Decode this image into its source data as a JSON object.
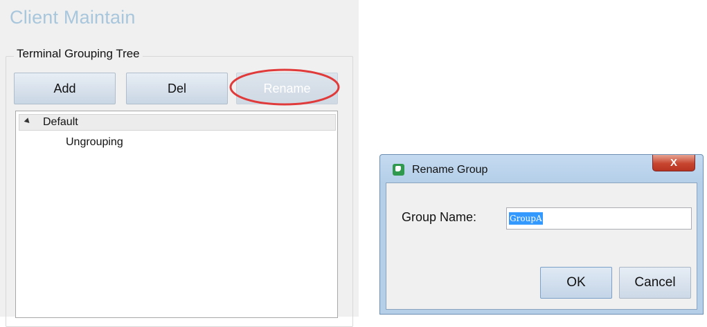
{
  "app": {
    "title": "Client Maintain"
  },
  "tree_panel": {
    "group_label": "Terminal Grouping Tree",
    "buttons": {
      "add": "Add",
      "del": "Del",
      "rename": "Rename"
    },
    "tree": {
      "root": "Default",
      "child": "Ungrouping"
    }
  },
  "dialog": {
    "title": "Rename Group",
    "close_glyph": "X",
    "field_label": "Group Name:",
    "field_value": "GroupA",
    "ok": "OK",
    "cancel": "Cancel"
  },
  "colors": {
    "annotation_ellipse": "#e03a3a",
    "selection": "#3399ff",
    "title_blue": "#a8c6dc"
  }
}
